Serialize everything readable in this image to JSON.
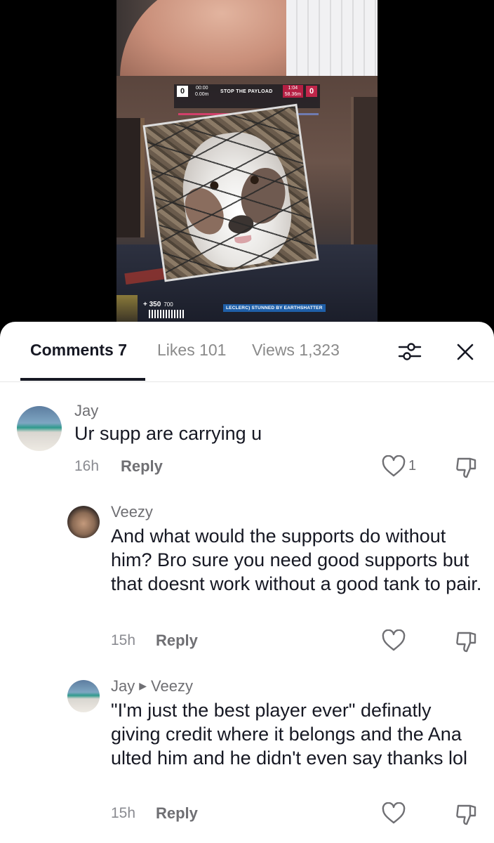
{
  "video": {
    "hud": {
      "left_score": "0",
      "left_time": "00:00",
      "left_distance": "0.00m",
      "mode_title": "STOP THE PAYLOAD",
      "right_time": "1:04",
      "right_distance": "58.36m",
      "right_score": "0",
      "ult_charge": "350",
      "ult_max": "700",
      "kill_feed": "LECLERC) STUNNED BY EARTHSHATTER"
    }
  },
  "tabs": {
    "comments": "Comments 7",
    "likes": "Likes 101",
    "views": "Views 1,323"
  },
  "comments": [
    {
      "author": "Jay",
      "text": "Ur supp are carrying u",
      "time": "16h",
      "reply_label": "Reply",
      "likes": "1"
    },
    {
      "author": "Veezy",
      "text": "And what would the supports do without him? Bro sure you need good supports but that doesnt work without a good tank to pair.",
      "time": "15h",
      "reply_label": "Reply"
    },
    {
      "author": "Jay",
      "reply_to": "Veezy",
      "text": "\"I'm just the best player ever\" definatly giving credit where it belongs and the Ana ulted him and he didn't even say thanks lol",
      "time": "15h",
      "reply_label": "Reply"
    }
  ],
  "icons": {
    "filter": "filter-icon",
    "close": "close-icon",
    "like": "heart-icon",
    "dislike": "thumbs-down-icon"
  },
  "colors": {
    "text_primary": "#161823",
    "text_secondary": "#8a8a8a"
  }
}
